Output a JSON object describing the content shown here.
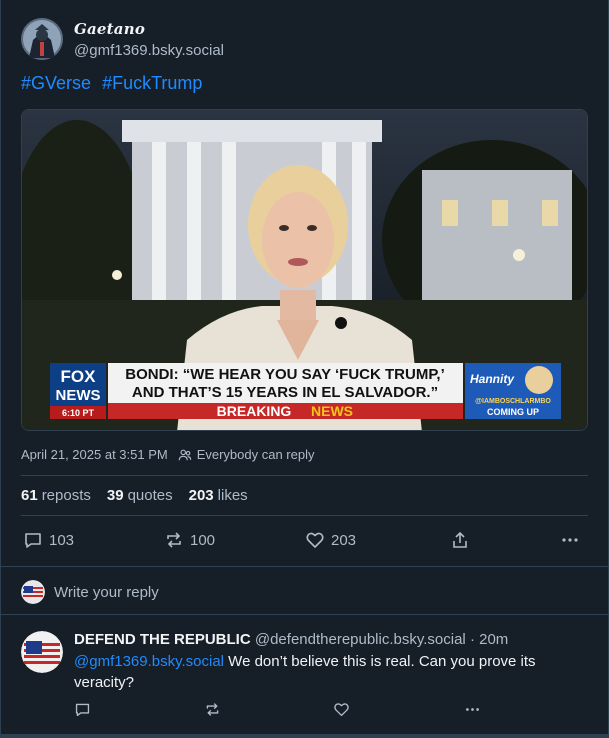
{
  "post": {
    "author": {
      "display_name": "Gaetano",
      "handle": "@gmf1369.bsky.social"
    },
    "hashtags": [
      "#GVerse",
      "#FuckTrump"
    ],
    "media": {
      "headline_line1": "BONDI: “WE HEAR YOU SAY ‘FUCK TRUMP,’",
      "headline_line2": "AND THAT’S 15 YEARS IN EL SALVADOR.”",
      "banner": "BREAKING",
      "banner_accent": "NEWS",
      "network_top": "FOX",
      "network_bottom": "NEWS",
      "network_time": "6:10 PT",
      "show_name": "Hannity",
      "show_handle": "@IAMBOSCHLARMBO",
      "show_next": "COMING UP"
    },
    "timestamp": "April 21, 2025 at 3:51 PM",
    "reply_permission": "Everybody can reply",
    "stats": {
      "reposts_count": "61",
      "reposts_label": "reposts",
      "quotes_count": "39",
      "quotes_label": "quotes",
      "likes_count": "203",
      "likes_label": "likes"
    },
    "actions": {
      "replies": "103",
      "reposts": "100",
      "likes": "203"
    }
  },
  "compose": {
    "placeholder": "Write your reply"
  },
  "reply": {
    "display_name": "DEFEND THE REPUBLIC",
    "handle": "@defendtherepublic.bsky.social",
    "time": "· 20m",
    "mention": "@gmf1369.bsky.social",
    "text": " We don’t believe this is real. Can you prove its veracity?"
  },
  "colors": {
    "background": "#161e27",
    "accent": "#208bfe",
    "muted": "#aebbc9",
    "border": "#2e4052"
  },
  "icons": [
    "people-icon",
    "reply-icon",
    "repost-icon",
    "heart-icon",
    "share-icon",
    "more-icon",
    "flag-avatar"
  ]
}
